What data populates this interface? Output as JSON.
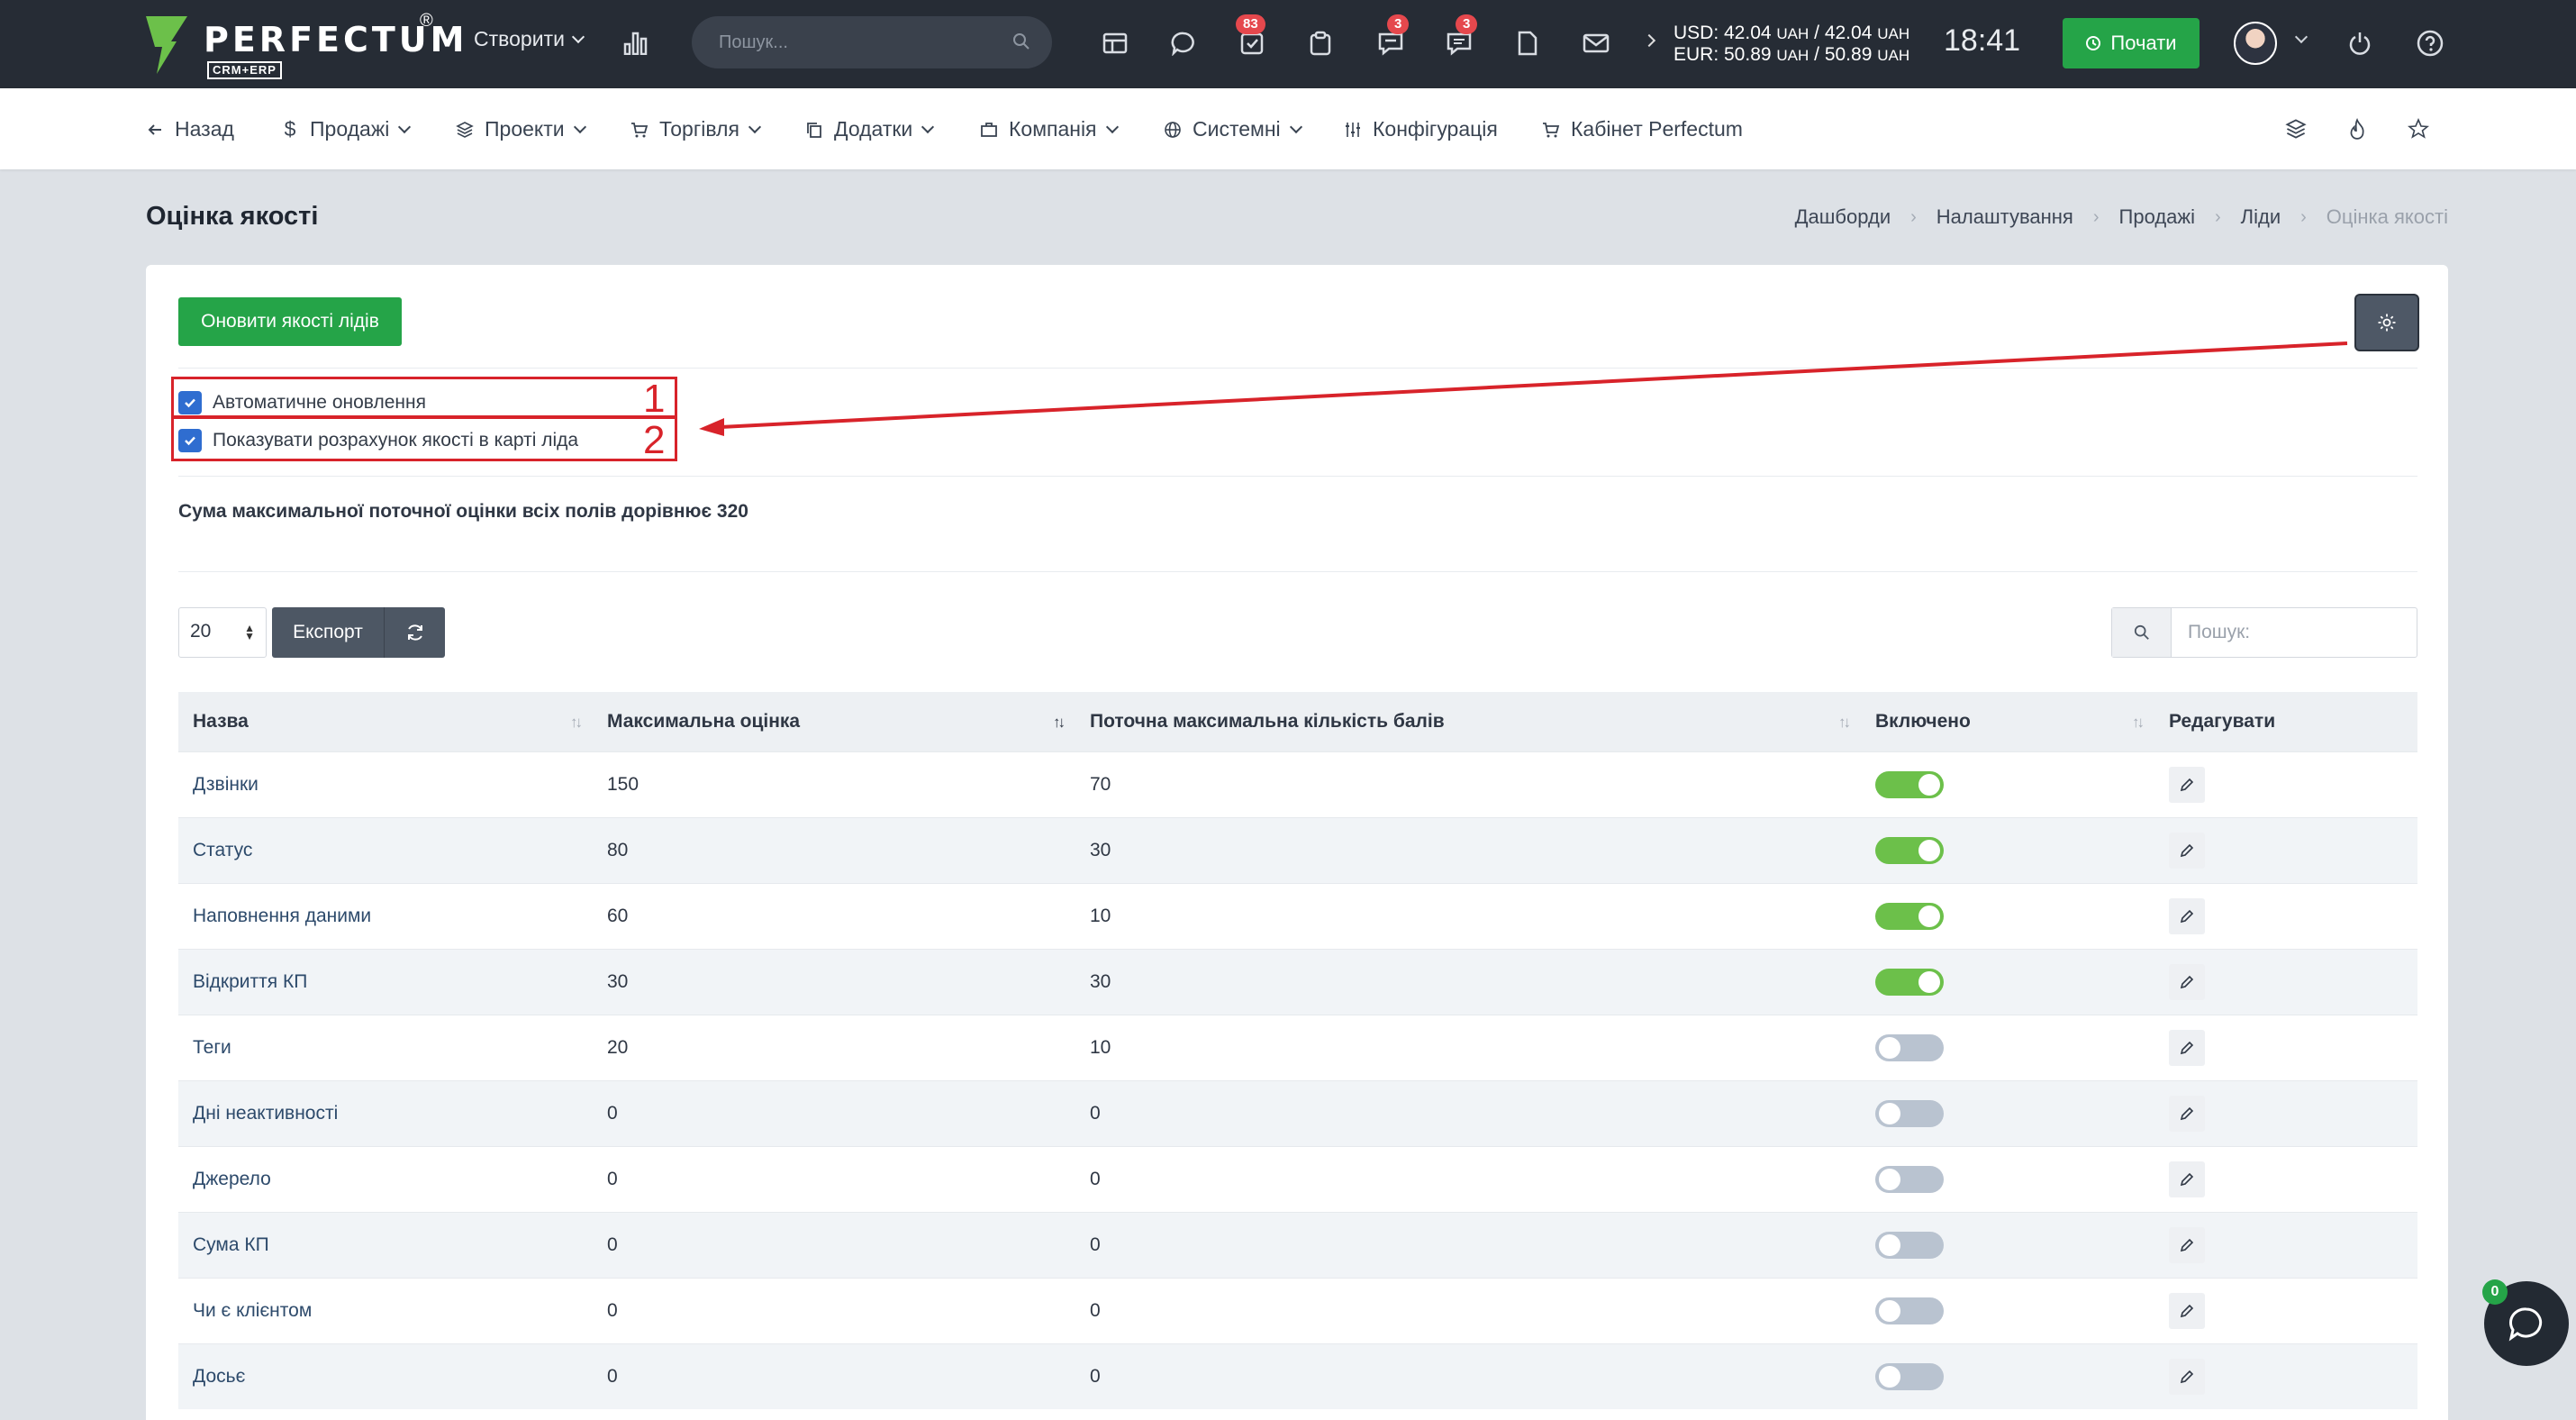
{
  "topbar": {
    "logo_name": "PERFECTUM",
    "logo_reg": "®",
    "logo_sub": "CRM+ERP",
    "create_label": "Створити",
    "search_placeholder": "Пошук...",
    "badges": {
      "tasks": "83",
      "chat": "3",
      "messages": "3"
    },
    "rates": {
      "usd_line": "USD: 42.04",
      "usd_unit1": "UAH",
      "usd_mid": "/ 42.04",
      "usd_unit2": "UAH",
      "eur_line": "EUR: 50.89",
      "eur_unit1": "UAH",
      "eur_mid": "/ 50.89",
      "eur_unit2": "UAH"
    },
    "clock": "18:41",
    "start_label": "Почати"
  },
  "nav": {
    "back": "Назад",
    "sales": "Продажі",
    "projects": "Проекти",
    "trade": "Торгівля",
    "addons": "Додатки",
    "company": "Компанія",
    "system": "Системні",
    "config": "Конфігурація",
    "cabinet": "Кабінет Perfectum"
  },
  "page": {
    "title": "Оцінка якості",
    "breadcrumb": [
      "Дашборди",
      "Налаштування",
      "Продажі",
      "Ліди",
      "Оцінка якості"
    ]
  },
  "panel": {
    "refresh_label": "Оновити якості лідів",
    "checkboxes": [
      {
        "label": "Автоматичне оновлення",
        "checked": true,
        "annotation": "1"
      },
      {
        "label": "Показувати розрахунок якості в карті ліда",
        "checked": true,
        "annotation": "2"
      }
    ],
    "sum_text": "Сума максимальної поточної оцінки всіх полів дорівнює 320",
    "per_page": "20",
    "export_label": "Експорт",
    "search_placeholder": "Пошук:"
  },
  "table": {
    "headers": [
      "Назва",
      "Максимальна оцінка",
      "Поточна максимальна кількість балів",
      "Включено",
      "Редагувати"
    ],
    "rows": [
      {
        "name": "Дзвінки",
        "max": "150",
        "current": "70",
        "enabled": true
      },
      {
        "name": "Статус",
        "max": "80",
        "current": "30",
        "enabled": true
      },
      {
        "name": "Наповнення даними",
        "max": "60",
        "current": "10",
        "enabled": true
      },
      {
        "name": "Відкриття КП",
        "max": "30",
        "current": "30",
        "enabled": true
      },
      {
        "name": "Теги",
        "max": "20",
        "current": "10",
        "enabled": false
      },
      {
        "name": "Дні неактивності",
        "max": "0",
        "current": "0",
        "enabled": false
      },
      {
        "name": "Джерело",
        "max": "0",
        "current": "0",
        "enabled": false
      },
      {
        "name": "Сума КП",
        "max": "0",
        "current": "0",
        "enabled": false
      },
      {
        "name": "Чи є клієнтом",
        "max": "0",
        "current": "0",
        "enabled": false
      },
      {
        "name": "Досьє",
        "max": "0",
        "current": "0",
        "enabled": false
      }
    ]
  },
  "chat": {
    "badge": "0"
  },
  "colors": {
    "accent_green": "#25a448",
    "topbar_bg": "#262c35",
    "annotation_red": "#d8232a",
    "toggle_on": "#6cc04a",
    "checkbox_blue": "#2f6dd0"
  }
}
